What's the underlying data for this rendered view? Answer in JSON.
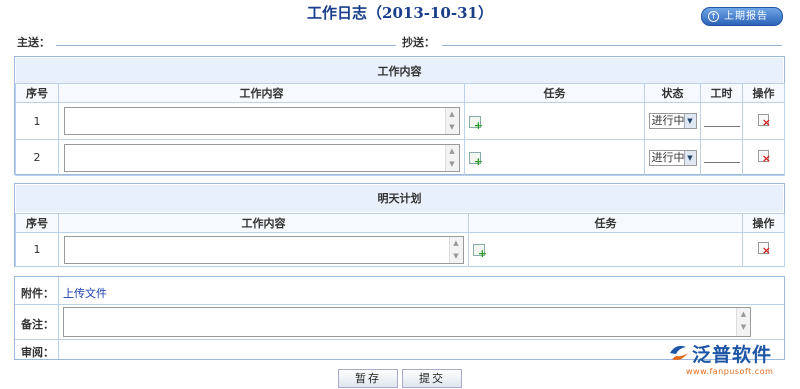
{
  "title": "工作日志（2013-10-31）",
  "prev_report_label": "上期报告",
  "header": {
    "to_label": "主送：",
    "cc_label": "抄送："
  },
  "work": {
    "section_title": "工作内容",
    "columns": [
      "序号",
      "工作内容",
      "任务",
      "状态",
      "工时",
      "操作"
    ],
    "rows": [
      {
        "no": "1",
        "status": "进行中"
      },
      {
        "no": "2",
        "status": "进行中"
      }
    ]
  },
  "plan": {
    "section_title": "明天计划",
    "columns": [
      "序号",
      "工作内容",
      "任务",
      "操作"
    ],
    "rows": [
      {
        "no": "1"
      }
    ]
  },
  "attachment": {
    "label": "附件：",
    "upload_link": "上传文件"
  },
  "remarks_label": "备注：",
  "review_label": "审阅：",
  "buttons": {
    "save": "暂存",
    "submit": "提交"
  },
  "watermark": {
    "brand": "泛普软件",
    "url": "www.fanpusoft.com"
  }
}
